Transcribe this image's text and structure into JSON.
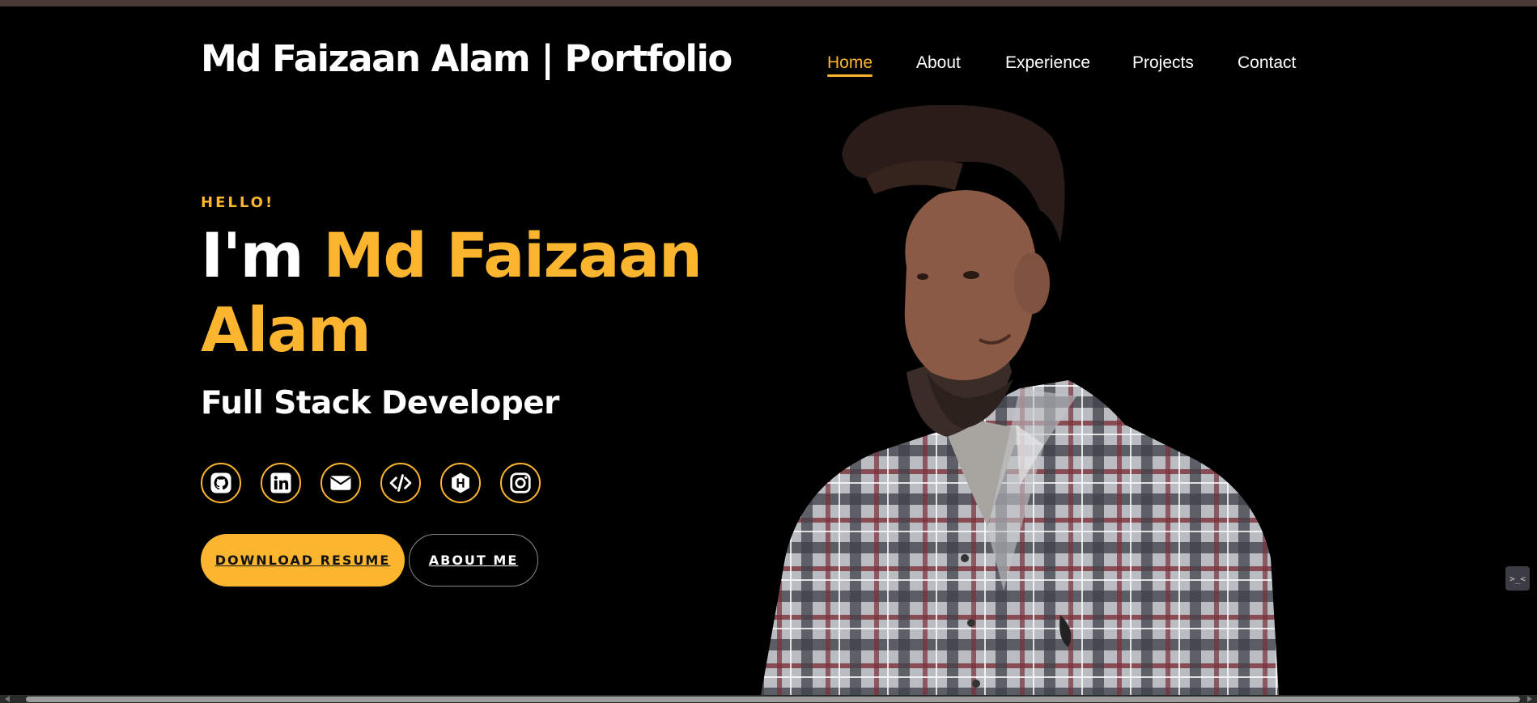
{
  "header": {
    "title": "Md Faizaan Alam | Portfolio",
    "nav": [
      {
        "label": "Home",
        "active": true
      },
      {
        "label": "About",
        "active": false
      },
      {
        "label": "Experience",
        "active": false
      },
      {
        "label": "Projects",
        "active": false
      },
      {
        "label": "Contact",
        "active": false
      }
    ]
  },
  "hero": {
    "greeting": "HELLO!",
    "intro": "I'm",
    "name": "Md Faizaan Alam",
    "role": "Full Stack Developer",
    "socials": [
      {
        "icon": "github-icon"
      },
      {
        "icon": "linkedin-icon"
      },
      {
        "icon": "email-icon"
      },
      {
        "icon": "code-icon"
      },
      {
        "icon": "hashnode-icon"
      },
      {
        "icon": "instagram-icon"
      }
    ],
    "buttons": {
      "resume": "DOWNLOAD RESUME",
      "about": "ABOUT ME"
    }
  },
  "widget": {
    "label": ">_<"
  },
  "colors": {
    "accent": "#fbb52f",
    "background": "#000000",
    "text": "#ffffff"
  }
}
